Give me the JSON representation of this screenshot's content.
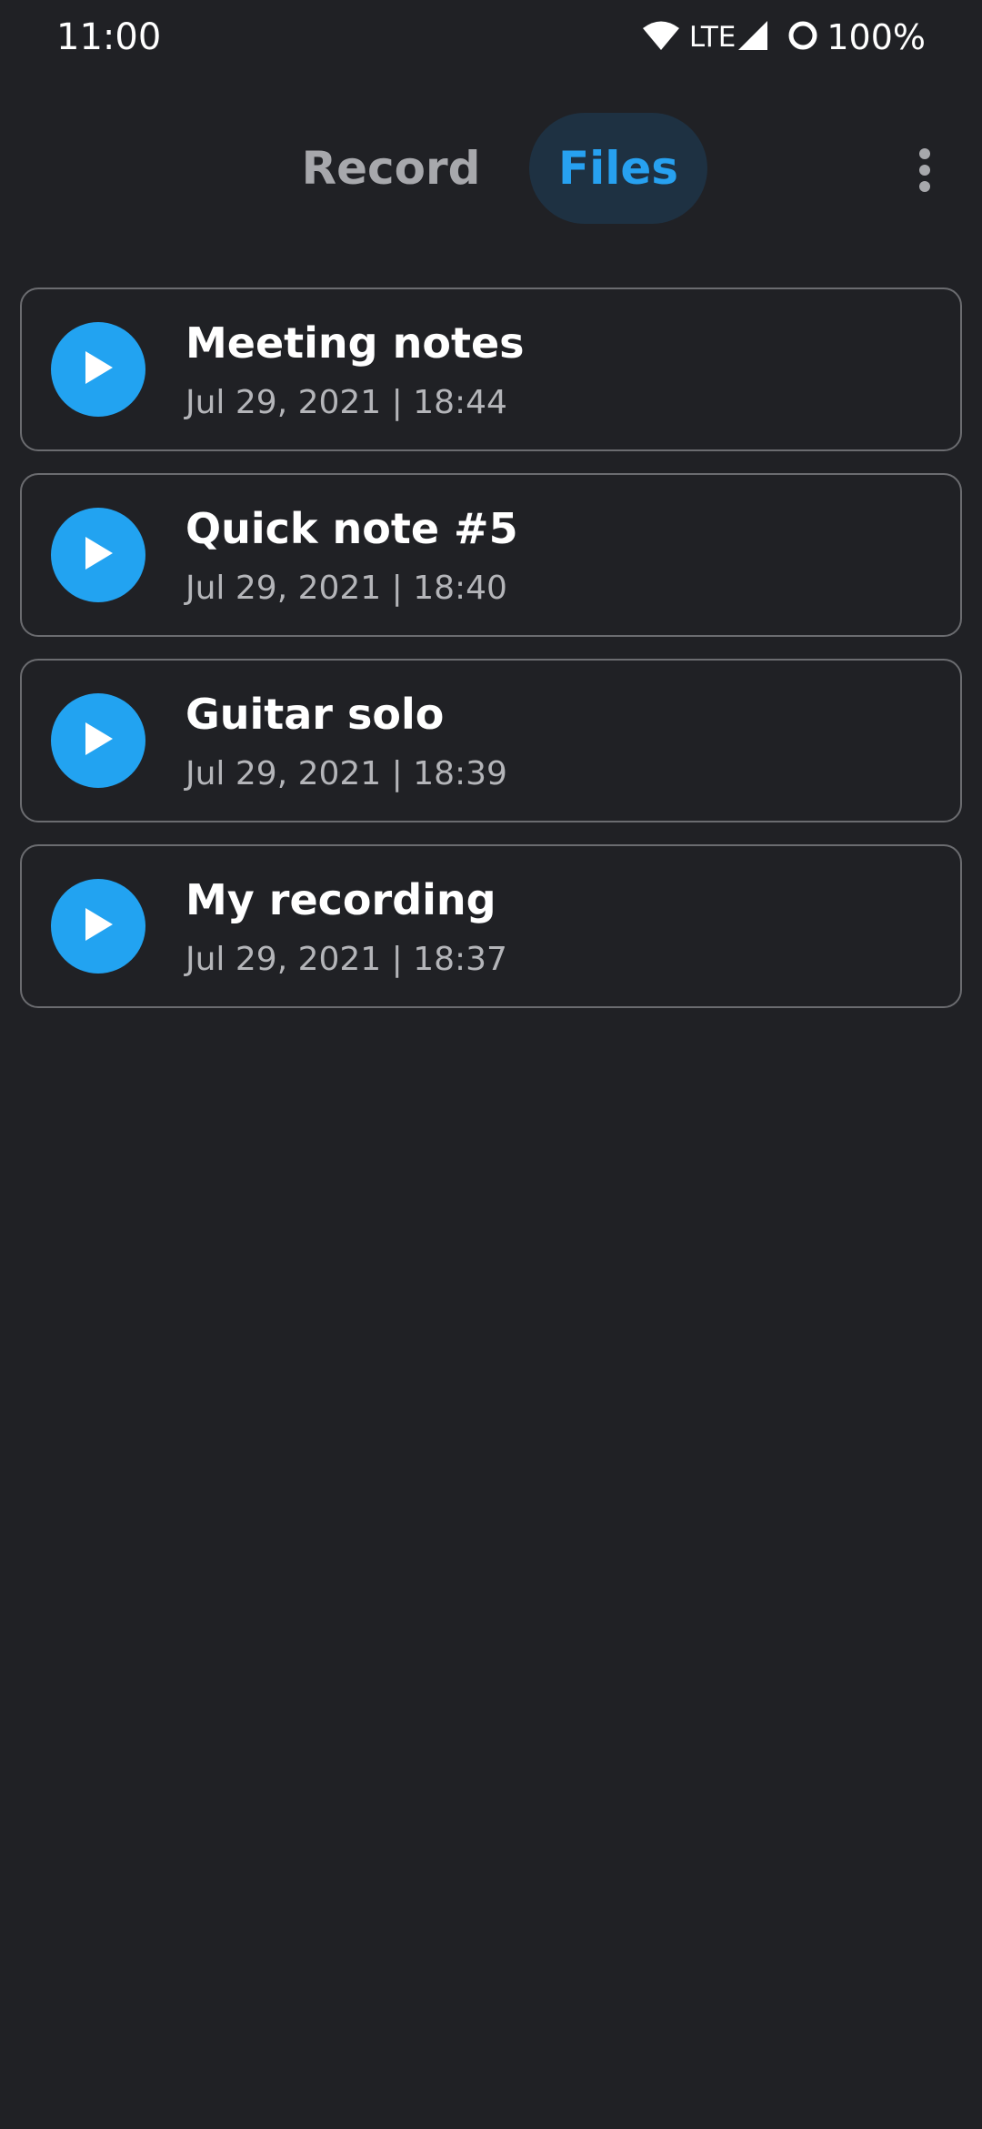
{
  "status_bar": {
    "time": "11:00",
    "network": "LTE",
    "battery": "100%",
    "icons": [
      "wifi-icon",
      "signal-icon",
      "battery-ring-icon"
    ]
  },
  "tabs": [
    {
      "label": "Record",
      "active": false
    },
    {
      "label": "Files",
      "active": true
    }
  ],
  "menu": {
    "icon": "more-vert-icon"
  },
  "colors": {
    "background": "#202125",
    "accent": "#22a3f1",
    "active_tab_bg": "#1e3142",
    "card_border": "#6b6c70"
  },
  "files": [
    {
      "title": "Meeting notes",
      "meta": "Jul 29, 2021 | 18:44",
      "icon": "play-icon"
    },
    {
      "title": "Quick note #5",
      "meta": "Jul 29, 2021 | 18:40",
      "icon": "play-icon"
    },
    {
      "title": "Guitar solo",
      "meta": "Jul 29, 2021 | 18:39",
      "icon": "play-icon"
    },
    {
      "title": "My recording",
      "meta": "Jul 29, 2021 | 18:37",
      "icon": "play-icon"
    }
  ]
}
